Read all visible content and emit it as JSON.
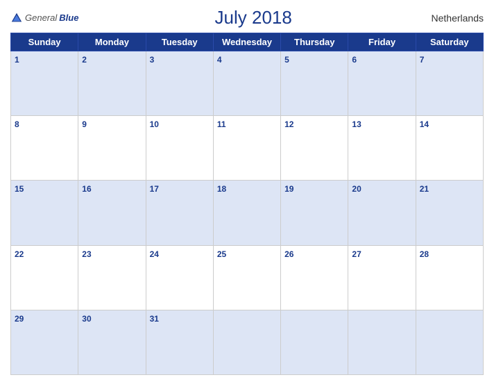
{
  "header": {
    "logo_general": "General",
    "logo_blue": "Blue",
    "title": "July 2018",
    "country": "Netherlands"
  },
  "weekdays": [
    "Sunday",
    "Monday",
    "Tuesday",
    "Wednesday",
    "Thursday",
    "Friday",
    "Saturday"
  ],
  "weeks": [
    [
      {
        "day": 1,
        "empty": false
      },
      {
        "day": 2,
        "empty": false
      },
      {
        "day": 3,
        "empty": false
      },
      {
        "day": 4,
        "empty": false
      },
      {
        "day": 5,
        "empty": false
      },
      {
        "day": 6,
        "empty": false
      },
      {
        "day": 7,
        "empty": false
      }
    ],
    [
      {
        "day": 8,
        "empty": false
      },
      {
        "day": 9,
        "empty": false
      },
      {
        "day": 10,
        "empty": false
      },
      {
        "day": 11,
        "empty": false
      },
      {
        "day": 12,
        "empty": false
      },
      {
        "day": 13,
        "empty": false
      },
      {
        "day": 14,
        "empty": false
      }
    ],
    [
      {
        "day": 15,
        "empty": false
      },
      {
        "day": 16,
        "empty": false
      },
      {
        "day": 17,
        "empty": false
      },
      {
        "day": 18,
        "empty": false
      },
      {
        "day": 19,
        "empty": false
      },
      {
        "day": 20,
        "empty": false
      },
      {
        "day": 21,
        "empty": false
      }
    ],
    [
      {
        "day": 22,
        "empty": false
      },
      {
        "day": 23,
        "empty": false
      },
      {
        "day": 24,
        "empty": false
      },
      {
        "day": 25,
        "empty": false
      },
      {
        "day": 26,
        "empty": false
      },
      {
        "day": 27,
        "empty": false
      },
      {
        "day": 28,
        "empty": false
      }
    ],
    [
      {
        "day": 29,
        "empty": false
      },
      {
        "day": 30,
        "empty": false
      },
      {
        "day": 31,
        "empty": false
      },
      {
        "day": null,
        "empty": true
      },
      {
        "day": null,
        "empty": true
      },
      {
        "day": null,
        "empty": true
      },
      {
        "day": null,
        "empty": true
      }
    ]
  ]
}
